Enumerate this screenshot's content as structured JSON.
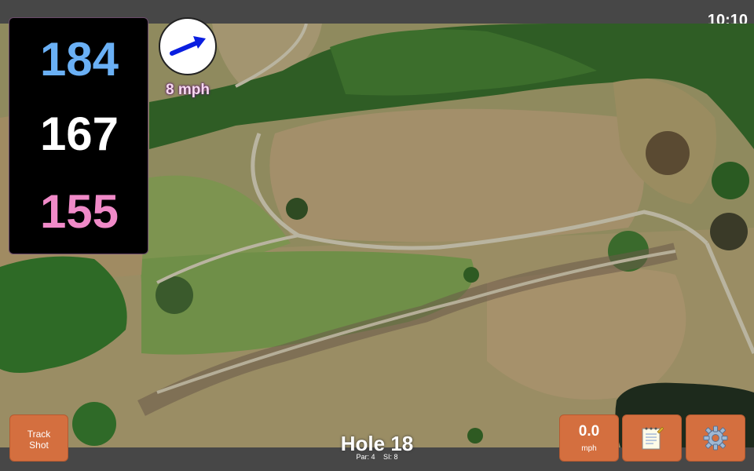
{
  "status": {
    "time": "10:10"
  },
  "yardages": {
    "back": "184",
    "middle": "167",
    "front": "155"
  },
  "wind": {
    "speed_label": "8 mph",
    "icon": "wind-direction-arrow-icon",
    "arrow_color": "#0a1ee0"
  },
  "buttons": {
    "track_shot": "Track\nShot",
    "speed_value": "0.0",
    "speed_unit": "mph",
    "notes_icon": "notepad-icon",
    "settings_icon": "gear-icon"
  },
  "hole": {
    "title": "Hole 18",
    "par": "Par: 4",
    "si": "SI: 8"
  },
  "colors": {
    "back": "#6ab0f5",
    "middle": "#ffffff",
    "front": "#f08ac8",
    "button": "#d46f3f"
  }
}
